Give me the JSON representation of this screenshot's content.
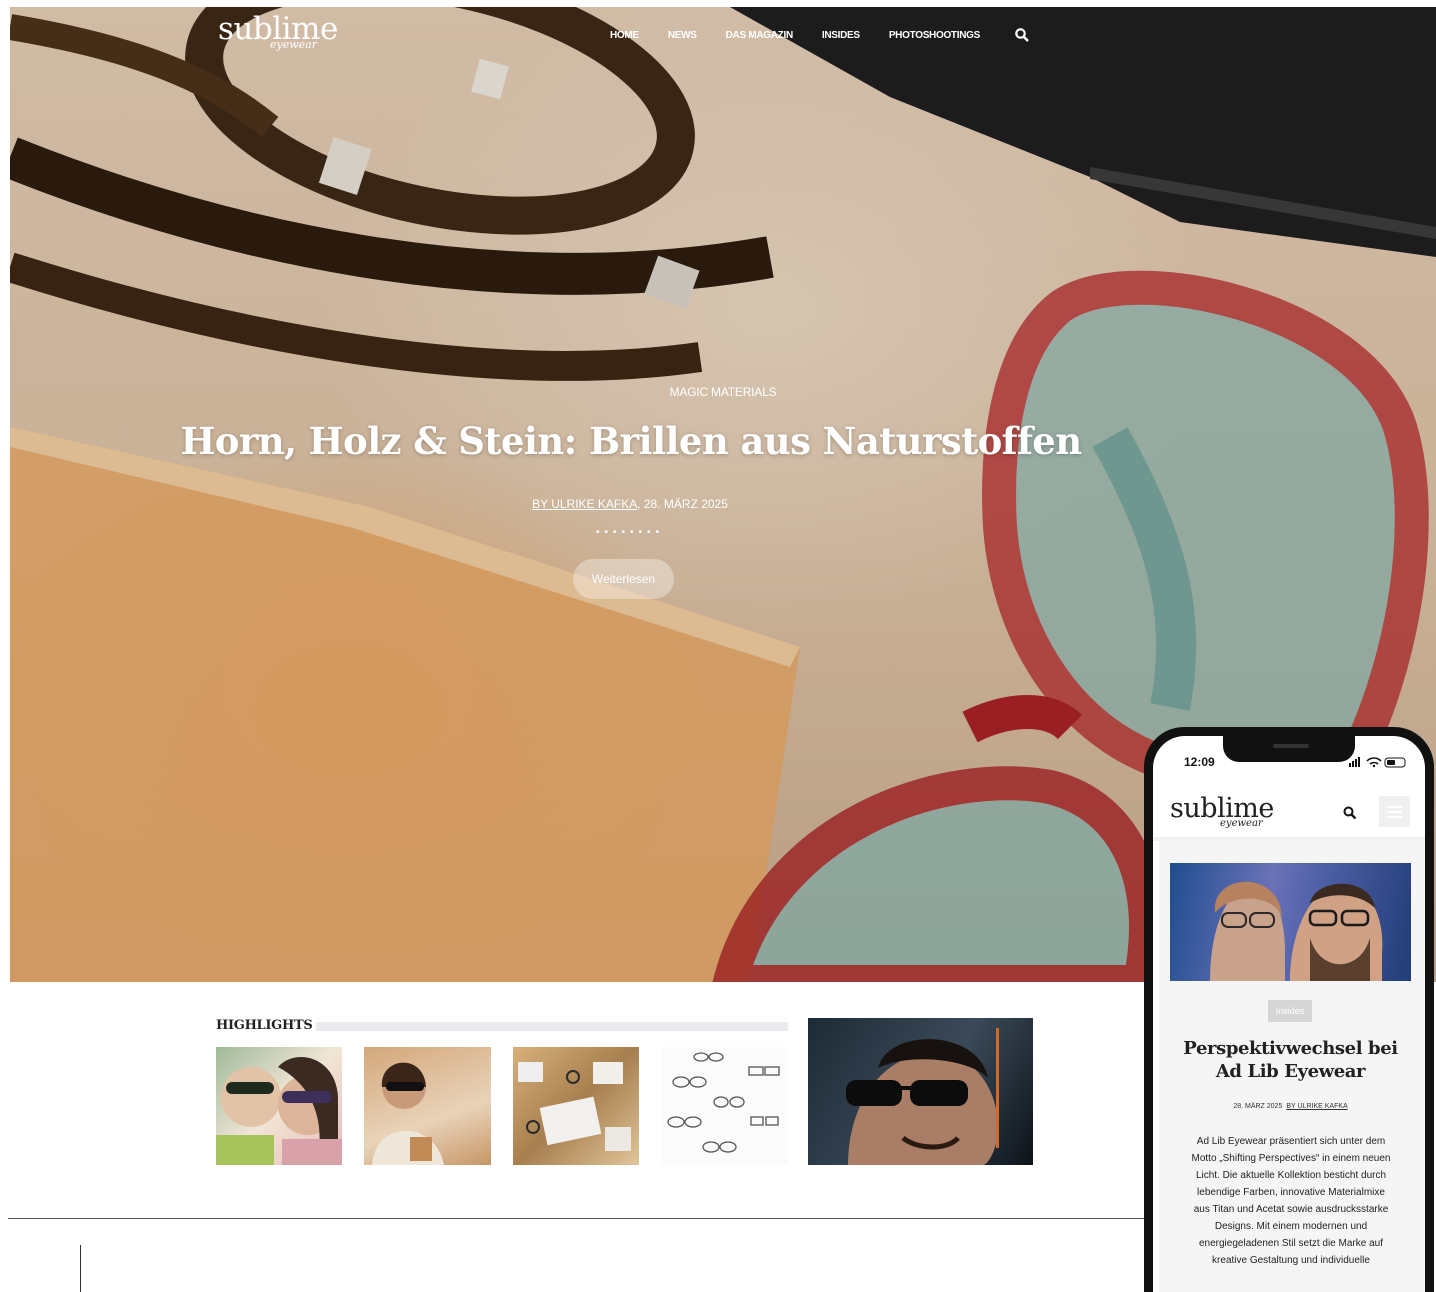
{
  "header": {
    "logo": "sublime",
    "logo_sub": "eyewear",
    "nav": [
      "HOME",
      "NEWS",
      "DAS MAGAZIN",
      "INSIDES",
      "PHOTOSHOOTINGS"
    ],
    "search_icon": "search-icon"
  },
  "hero": {
    "category": "MAGIC MATERIALS",
    "title": "Horn, Holz & Stein: Brillen aus Naturstoffen",
    "author": "BY ULRIKE KAFKA",
    "date": ", 28. MÄRZ 2025",
    "dots": "••••••••",
    "button": "Weiterlesen"
  },
  "highlights": {
    "title": "HIGHLIGHTS",
    "items": [
      "sunglasses-couple",
      "woman-sunglasses",
      "optician-workspace",
      "eyewear-sketches",
      "man-sunglasses-campaign"
    ]
  },
  "phone": {
    "time": "12:09",
    "logo": "sublime",
    "logo_sub": "eyewear",
    "tag": "Insides",
    "title": "Perspektivwechsel bei Ad Lib Eyewear",
    "date": "28. MÄRZ 2025",
    "author": "BY ULRIKE KAFKA",
    "body": "Ad Lib Eyewear präsentiert sich unter dem Motto „Shifting Perspectives“ in einem neuen Licht. Die aktuelle Kollektion besticht durch lebendige Farben, innovative Materialmixe aus Titan und Acetat sowie ausdrucksstarke Designs. Mit einem modernen und energiegeladenen Stil setzt die Marke auf kreative Gestaltung und individuelle"
  }
}
